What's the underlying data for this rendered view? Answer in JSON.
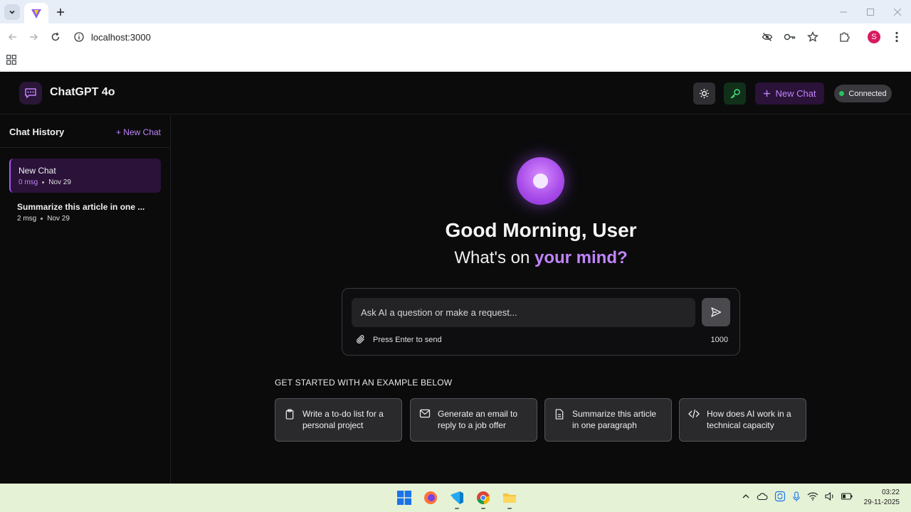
{
  "browser": {
    "url": "localhost:3000",
    "profile_initial": "S"
  },
  "app": {
    "title": "ChatGPT 4o",
    "new_chat_label": "New Chat",
    "status": "Connected",
    "colors": {
      "accent": "#c084fc",
      "status_ok": "#22c55e"
    }
  },
  "sidebar": {
    "title": "Chat History",
    "new_chat_link": "+ New Chat",
    "chats": [
      {
        "title": "New Chat",
        "count": "0 msg",
        "date": "Nov 29"
      },
      {
        "title": "Summarize this article in one ...",
        "count": "2 msg",
        "date": "Nov 29"
      }
    ]
  },
  "main": {
    "greeting": "Good Morning, User",
    "subtitle_prefix": "What's on",
    "subtitle_highlight": "your mind?",
    "input_placeholder": "Ask AI a question or make a request...",
    "hint": "Press Enter to send",
    "char_counter": "1000",
    "examples_heading": "GET STARTED WITH AN EXAMPLE BELOW",
    "examples": [
      {
        "icon": "clipboard-icon",
        "text": "Write a to-do list for a personal project"
      },
      {
        "icon": "mail-icon",
        "text": "Generate an email to reply to a job offer"
      },
      {
        "icon": "document-icon",
        "text": "Summarize this article in one paragraph"
      },
      {
        "icon": "code-icon",
        "text": "How does AI work in a technical capacity"
      }
    ]
  },
  "taskbar": {
    "time": "03:22",
    "date": "29-11-2025"
  }
}
